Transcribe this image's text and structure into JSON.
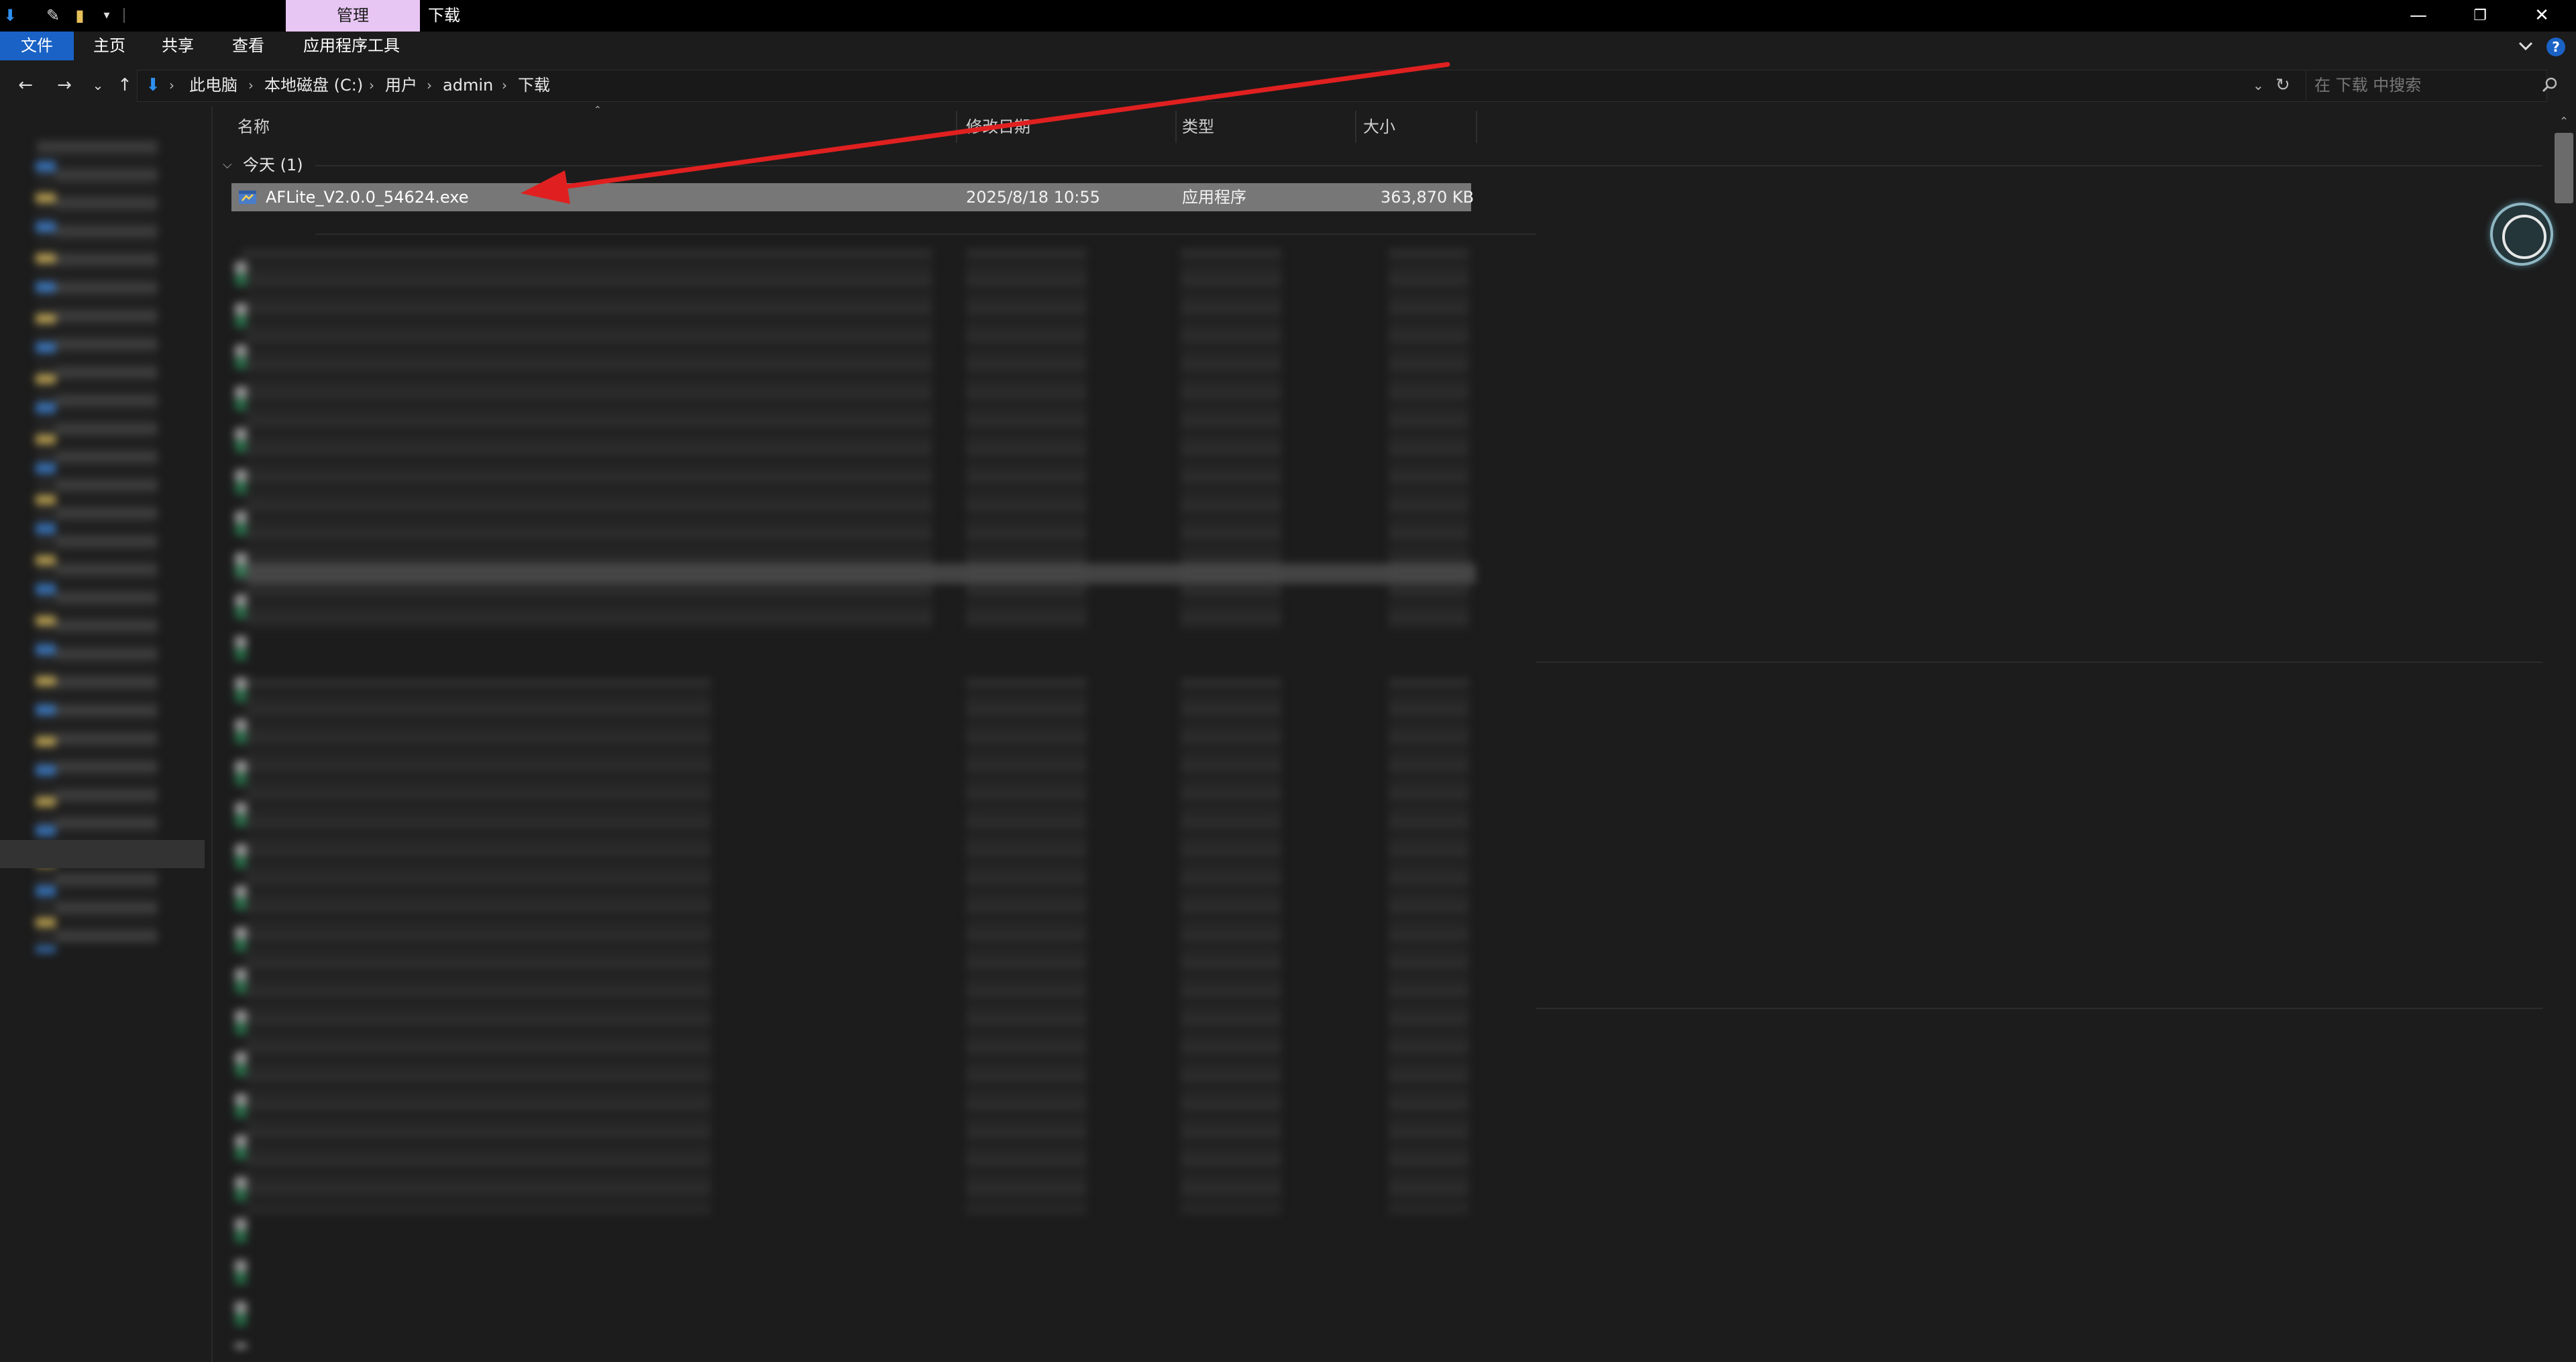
{
  "window": {
    "title": "下载",
    "manage_tab": "管理",
    "buttons": {
      "minimize": "—",
      "restore": "❐",
      "close": "✕"
    }
  },
  "qat": {
    "dropdown": "▾"
  },
  "ribbon": {
    "tabs": [
      "文件",
      "主页",
      "共享",
      "查看",
      "应用程序工具"
    ],
    "collapse_icon": "chevron-down-icon",
    "help_label": "?"
  },
  "nav": {
    "back": "←",
    "forward": "→",
    "recent": "⌄",
    "up": "↑",
    "breadcrumb": [
      "此电脑",
      "本地磁盘 (C:)",
      "用户",
      "admin",
      "下载"
    ],
    "refresh": "↻",
    "history_dropdown": "⌄"
  },
  "search": {
    "placeholder": "在 下载 中搜索"
  },
  "columns": {
    "name": "名称",
    "modified": "修改日期",
    "type": "类型",
    "size": "大小"
  },
  "group": {
    "label": "今天 (1)"
  },
  "files": [
    {
      "name": "AFLite_V2.0.0_54624.exe",
      "modified": "2025/8/18 10:55",
      "type": "应用程序",
      "size": "363,870 KB"
    }
  ],
  "colors": {
    "accent": "#1a62c5",
    "manage_tab": "#e8c6f3",
    "annotation_arrow": "#e02020",
    "selected_row": "#777777"
  }
}
